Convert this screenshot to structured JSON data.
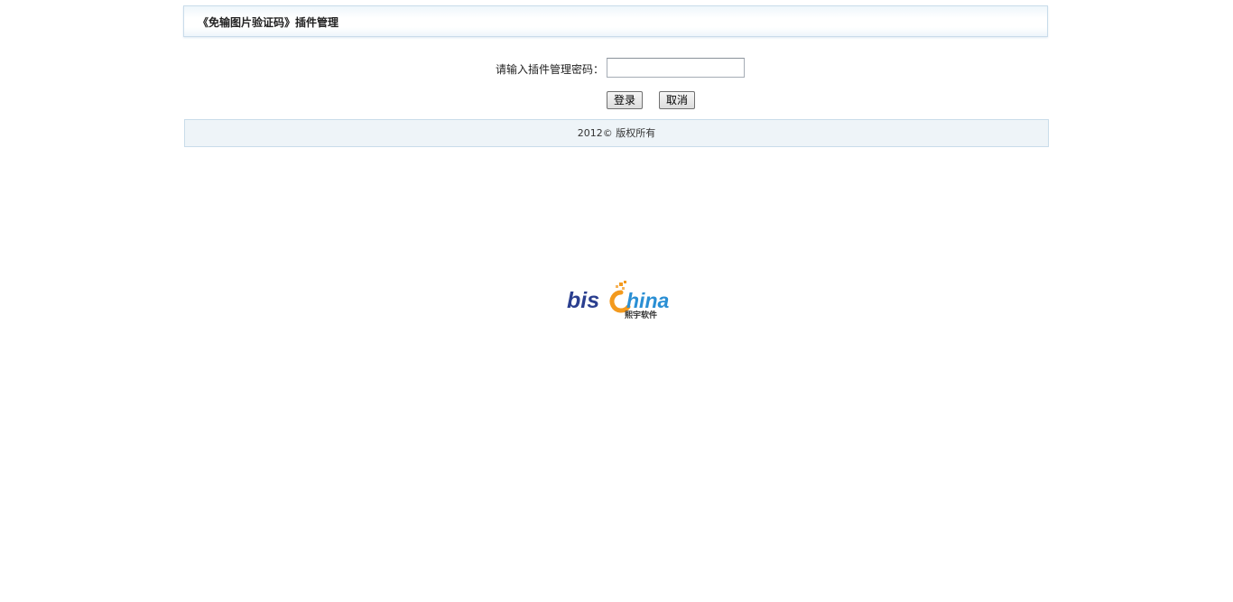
{
  "header": {
    "title": "《免输图片验证码》插件管理"
  },
  "login_form": {
    "password_label": "请输入插件管理密码：",
    "password_value": "",
    "login_button": "登录",
    "cancel_button": "取消"
  },
  "footer": {
    "copyright": "2012© 版权所有"
  },
  "logo": {
    "text_primary": "bis",
    "text_secondary": "hina",
    "subtitle": "熙宇软件",
    "colors": {
      "blue": "#2b3f8f",
      "orange": "#f39a1e",
      "light_blue": "#2a8fd4"
    }
  }
}
